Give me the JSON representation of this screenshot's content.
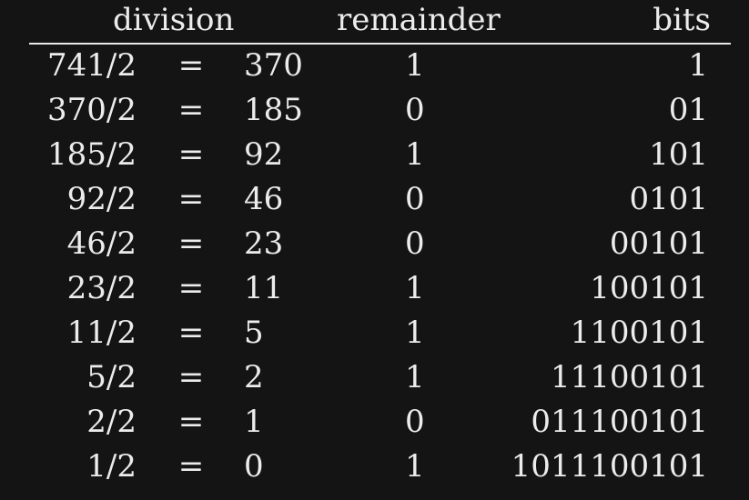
{
  "headers": {
    "division": "division",
    "remainder": "remainder",
    "bits": "bits"
  },
  "rows": [
    {
      "division": "741/2",
      "equals": "=",
      "quotient": "370",
      "remainder": "1",
      "bits": "1"
    },
    {
      "division": "370/2",
      "equals": "=",
      "quotient": "185",
      "remainder": "0",
      "bits": "01"
    },
    {
      "division": "185/2",
      "equals": "=",
      "quotient": "92",
      "remainder": "1",
      "bits": "101"
    },
    {
      "division": "92/2",
      "equals": "=",
      "quotient": "46",
      "remainder": "0",
      "bits": "0101"
    },
    {
      "division": "46/2",
      "equals": "=",
      "quotient": "23",
      "remainder": "0",
      "bits": "00101"
    },
    {
      "division": "23/2",
      "equals": "=",
      "quotient": "11",
      "remainder": "1",
      "bits": "100101"
    },
    {
      "division": "11/2",
      "equals": "=",
      "quotient": "5",
      "remainder": "1",
      "bits": "1100101"
    },
    {
      "division": "5/2",
      "equals": "=",
      "quotient": "2",
      "remainder": "1",
      "bits": "11100101"
    },
    {
      "division": "2/2",
      "equals": "=",
      "quotient": "1",
      "remainder": "0",
      "bits": "011100101"
    },
    {
      "division": "1/2",
      "equals": "=",
      "quotient": "0",
      "remainder": "1",
      "bits": "1011100101"
    }
  ]
}
